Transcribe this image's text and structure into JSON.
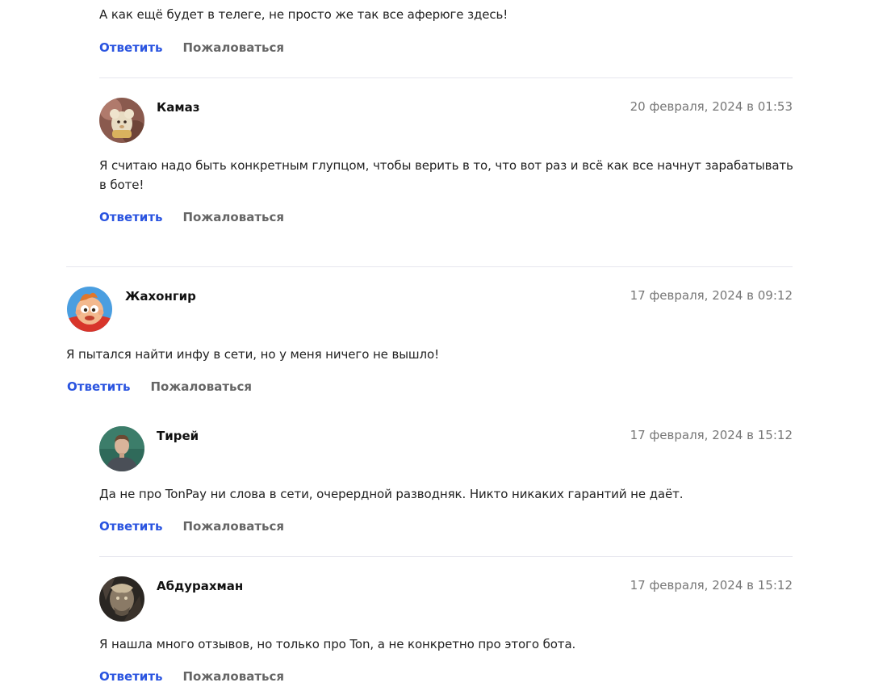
{
  "actions": {
    "reply_label": "Ответить",
    "report_label": "Пожаловаться"
  },
  "comments": [
    {
      "author": "",
      "date": "",
      "text": "А как ещё будет в телеге, не просто же так все аферюге здесь!",
      "avatar_icon": ""
    },
    {
      "author": "Камаз",
      "date": "20 февраля, 2024 в 01:53",
      "text": "Я считаю надо быть конкретным глупцом, чтобы верить в то, что вот раз и всё как все начнут зарабатывать в боте!",
      "avatar_icon": "teddy-bear-avatar-icon"
    },
    {
      "author": "Жахонгир",
      "date": "17 февраля, 2024 в 09:12",
      "text": "Я пытался найти инфу в сети, но у меня ничего не вышло!",
      "avatar_icon": "cartoon-baby-avatar-icon"
    },
    {
      "author": "Тирей",
      "date": "17 февраля, 2024 в 15:12",
      "text": "Да не про TonPay ни слова в сети, очерердной разводняк. Никто никаких гарантий не даёт.",
      "avatar_icon": "man-photo-avatar-icon"
    },
    {
      "author": "Абдурахман",
      "date": "17 февраля, 2024 в 15:12",
      "text": "Я нашла много отзывов, но только про Ton, а не конкретно про этого бота.",
      "avatar_icon": "warrior-art-avatar-icon"
    }
  ]
}
